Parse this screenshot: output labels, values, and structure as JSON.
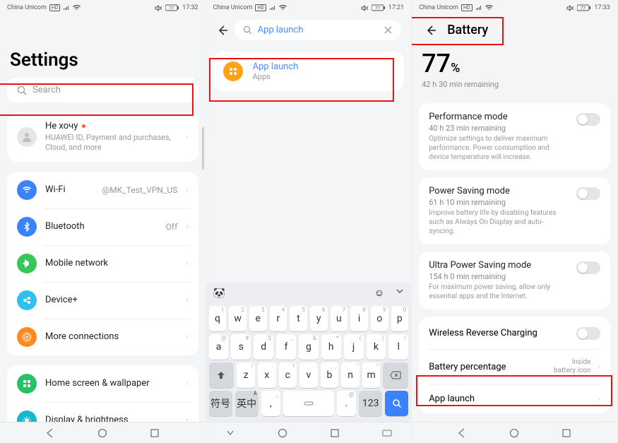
{
  "status": {
    "carrier": "China Unicom",
    "signal_badge": "HD",
    "time1": "17:32",
    "time2": "17:21",
    "time3": "17:33",
    "battery_icon": "77"
  },
  "screen1": {
    "title": "Settings",
    "search_placeholder": "Search",
    "account": {
      "name": "Не хочу",
      "sub": "HUAWEI ID, Payment and purchases, Cloud, and more"
    },
    "items": [
      {
        "label": "Wi-Fi",
        "value": "@MK_Test_VPN_US"
      },
      {
        "label": "Bluetooth",
        "value": "Off"
      },
      {
        "label": "Mobile network",
        "value": ""
      },
      {
        "label": "Device+",
        "value": ""
      },
      {
        "label": "More connections",
        "value": ""
      }
    ],
    "items2": [
      {
        "label": "Home screen & wallpaper"
      },
      {
        "label": "Display & brightness"
      }
    ]
  },
  "screen2": {
    "query": "App launch",
    "result_title": "App launch",
    "result_sub": "Apps",
    "keyboard": {
      "row1": [
        "q",
        "w",
        "e",
        "r",
        "t",
        "y",
        "u",
        "i",
        "o",
        "p"
      ],
      "sup1": [
        "1",
        "2",
        "3",
        "4",
        "5",
        "6",
        "7",
        "8",
        "9",
        "0"
      ],
      "row2": [
        "a",
        "s",
        "d",
        "f",
        "g",
        "h",
        "j",
        "k",
        "l"
      ],
      "sup2": [
        "@",
        "#",
        "$",
        "_",
        "&",
        "*",
        "(",
        ")",
        "/"
      ],
      "row3": [
        "z",
        "x",
        "c",
        "v",
        "b",
        "n",
        "m"
      ],
      "sup3": [
        "!",
        ":",
        "?",
        ".",
        ",",
        "'",
        "\""
      ],
      "br_sym": "符号",
      "br_lang": "英中",
      "br_123": "123"
    }
  },
  "screen3": {
    "title": "Battery",
    "pct": "77",
    "pct_unit": "%",
    "remaining": "42 h 30 min remaining",
    "modes": [
      {
        "t": "Performance mode",
        "r": "40 h 23 min remaining",
        "d": "Optimize settings to deliver maximum performance. Power consumption and device temperature will increase."
      },
      {
        "t": "Power Saving mode",
        "r": "61 h 10 min remaining",
        "d": "Improve battery life by disabling features such as Always On Display and auto-syncing."
      },
      {
        "t": "Ultra Power Saving mode",
        "r": "154 h 0 min remaining",
        "d": "For maximum power saving, allow only essential apps and the Internet."
      }
    ],
    "rows": [
      {
        "t": "Wireless Reverse Charging",
        "type": "toggle"
      },
      {
        "t": "Battery percentage",
        "v": "Inside\nbattery icon"
      },
      {
        "t": "App launch",
        "v": ""
      }
    ]
  }
}
